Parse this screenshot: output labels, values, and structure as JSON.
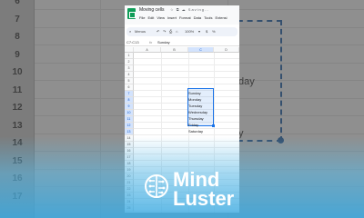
{
  "background": {
    "row_numbers": [
      "6",
      "7",
      "8",
      "9",
      "10",
      "11",
      "12",
      "13",
      "14",
      "15",
      "16",
      "17"
    ],
    "day_fragments": [
      "day",
      "y"
    ]
  },
  "window": {
    "doc_title": "Moving cells",
    "doc_status_icons": "☆ ⧉ ☁ Saving…"
  },
  "menu": [
    "File",
    "Edit",
    "View",
    "Insert",
    "Format",
    "Data",
    "Tools",
    "Extensi"
  ],
  "toolbar": {
    "search_label": "Menus",
    "zoom": "100%",
    "currency": "$",
    "percent": "%"
  },
  "formula_bar": {
    "name_box": "C7:C13",
    "fx": "fx",
    "value": "Sunday"
  },
  "sheet": {
    "columns": [
      "A",
      "B",
      "C",
      "D"
    ],
    "selected_column": "C",
    "rows": [
      "1",
      "2",
      "3",
      "4",
      "5",
      "6",
      "7",
      "8",
      "9",
      "10",
      "11",
      "12",
      "13",
      "14",
      "15",
      "16",
      "17",
      "18",
      "19",
      "20",
      "21",
      "22",
      "23",
      "24",
      "25"
    ],
    "selected_rows": [
      "7",
      "8",
      "9",
      "10",
      "11",
      "12",
      "13"
    ],
    "cells_c": [
      "Sunday",
      "Monday",
      "Tuesday",
      "Wednesday",
      "Thursday",
      "Friday",
      "Saturday"
    ]
  },
  "watermark": {
    "line1": "Mind",
    "line2": "Luster"
  },
  "colors": {
    "sheets_green": "#0f9d58",
    "selection_blue": "#1a73e8",
    "watermark_white": "#ffffff"
  }
}
